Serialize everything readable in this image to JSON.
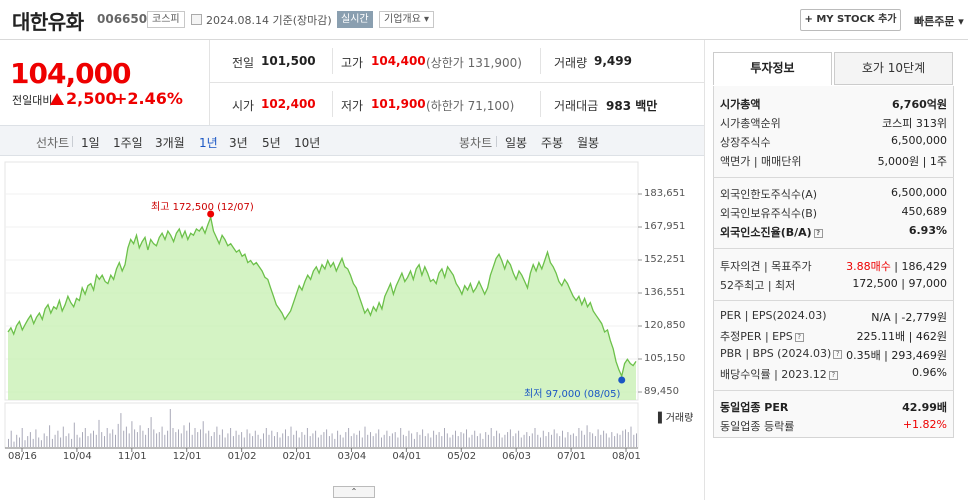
{
  "header": {
    "company_name": "대한유화",
    "code": "006650",
    "market": "코스피",
    "date_text": "2024.08.14  기준(장마감)",
    "realtime": "실시간",
    "company_overview": "기업개요 ▾",
    "mystock_button": "+ MY STOCK 추가",
    "quick_order": "빠른주문 ▾"
  },
  "price": {
    "current": "104,000",
    "change_label": "전일대비",
    "change_amount": "2,500",
    "change_percent": "+2.46%"
  },
  "stats": {
    "prev_close_label": "전일",
    "prev_close": "101,500",
    "high_label": "고가",
    "high": "104,400",
    "upper_limit": "(상한가 131,900)",
    "volume_label": "거래량",
    "volume": "9,499",
    "open_label": "시가",
    "open": "102,400",
    "low_label": "저가",
    "low": "101,900",
    "lower_limit": "(하한가 71,100)",
    "trade_value_label": "거래대금",
    "trade_value": "983 백만"
  },
  "tabs": {
    "line_label": "선차트",
    "line_periods": [
      "1일",
      "1주일",
      "3개월",
      "1년",
      "3년",
      "5년",
      "10년"
    ],
    "active_period": "1년",
    "candle_label": "봉차트",
    "candle_periods": [
      "일봉",
      "주봉",
      "월봉"
    ]
  },
  "chart": {
    "max_label": "최고 172,500 (12/07)",
    "min_label": "최저 97,000 (08/05)",
    "volume_label": "▌거래량",
    "toggle": "⌃",
    "accent_line": "#6cc04a",
    "accent_fill": "#c9f0b5"
  },
  "chart_data": {
    "type": "area",
    "y_ticks": [
      "183,651",
      "167,951",
      "152,251",
      "136,551",
      "120,850",
      "105,150",
      "89,450"
    ],
    "ylim": [
      89450,
      183651
    ],
    "x_ticks": [
      "08/16",
      "10/04",
      "11/01",
      "12/01",
      "01/02",
      "02/01",
      "03/04",
      "04/01",
      "05/02",
      "06/03",
      "07/01",
      "08/01"
    ],
    "series": [
      {
        "values": [
          118000,
          120000,
          117000,
          121000,
          123000,
          119000,
          121500,
          124000,
          126000,
          122000,
          125000,
          127000,
          124000,
          129000,
          131000,
          127000,
          130000,
          129000,
          133000,
          128000,
          131000,
          135000,
          132000,
          130000,
          134000,
          133000,
          139000,
          136000,
          140000,
          141000,
          138000,
          145000,
          143000,
          145000,
          142000,
          141000,
          145000,
          143000,
          148000,
          151000,
          147000,
          150000,
          158000,
          162000,
          160000,
          164000,
          158000,
          161000,
          163000,
          157000,
          162000,
          160000,
          159000,
          163000,
          165000,
          162000,
          166000,
          164000,
          161000,
          165000,
          167000,
          163000,
          166000,
          162000,
          165000,
          164000,
          167000,
          166000,
          168000,
          165000,
          169000,
          172500,
          166000,
          163000,
          160000,
          164000,
          162000,
          159000,
          160000,
          158000,
          156000,
          157000,
          154000,
          155000,
          151000,
          152000,
          150000,
          151000,
          149000,
          147000,
          144000,
          143000,
          139000,
          135000,
          131000,
          129000,
          127000,
          124000,
          126000,
          128000,
          132000,
          136000,
          140000,
          138000,
          142000,
          145000,
          143000,
          147000,
          149000,
          146000,
          150000,
          148000,
          152000,
          149000,
          151000,
          147000,
          150000,
          153000,
          149000,
          148000,
          145000,
          141000,
          139000,
          135000,
          131000,
          127000,
          129000,
          126000,
          130000,
          128000,
          132000,
          129000,
          135000,
          138000,
          141000,
          136000,
          140000,
          143000,
          146000,
          142000,
          144000,
          147000,
          143000,
          148000,
          150000,
          145000,
          149000,
          146000,
          142000,
          143000,
          141000,
          146000,
          148000,
          144000,
          149000,
          147000,
          145000,
          141000,
          139000,
          136000,
          140000,
          138000,
          141000,
          137000,
          139000,
          142000,
          139000,
          136000,
          139000,
          145000,
          149000,
          153000,
          155000,
          152000,
          148000,
          152000,
          150000,
          146000,
          143000,
          147000,
          145000,
          142000,
          139000,
          146000,
          150000,
          147000,
          151000,
          148000,
          152000,
          156000,
          151000,
          149000,
          146000,
          142000,
          140000,
          143000,
          141000,
          138000,
          135000,
          133000,
          135000,
          131000,
          134000,
          130000,
          132000,
          128000,
          126000,
          124000,
          122000,
          118000,
          119000,
          114000,
          110000,
          104000,
          100000,
          97000,
          103000,
          105000,
          103000,
          102000,
          104000
        ]
      }
    ],
    "volume": {
      "label": "거래량",
      "values": [
        6,
        12,
        4,
        9,
        7,
        14,
        5,
        8,
        11,
        6,
        13,
        7,
        5,
        10,
        8,
        16,
        6,
        9,
        12,
        7,
        15,
        8,
        10,
        6,
        18,
        9,
        7,
        11,
        14,
        8,
        10,
        12,
        9,
        20,
        11,
        8,
        14,
        10,
        13,
        9,
        17,
        25,
        12,
        15,
        10,
        19,
        13,
        11,
        16,
        12,
        9,
        14,
        22,
        13,
        10,
        11,
        15,
        9,
        12,
        28,
        14,
        11,
        13,
        10,
        16,
        12,
        18,
        9,
        14,
        11,
        13,
        19,
        10,
        12,
        8,
        11,
        15,
        9,
        13,
        7,
        10,
        14,
        8,
        12,
        9,
        11,
        7,
        13,
        10,
        8,
        12,
        9,
        6,
        10,
        14,
        9,
        12,
        8,
        11,
        7,
        10,
        13,
        8,
        15,
        9,
        12,
        7,
        11,
        9,
        14,
        8,
        10,
        12,
        7,
        9,
        11,
        13,
        8,
        10,
        6,
        12,
        9,
        7,
        11,
        14,
        8,
        10,
        9,
        12,
        7,
        15,
        9,
        11,
        8,
        10,
        13,
        7,
        9,
        12,
        8,
        10,
        11,
        7,
        14,
        9,
        8,
        12,
        10,
        6,
        11,
        9,
        13,
        8,
        10,
        7,
        12,
        9,
        11,
        8,
        14,
        10,
        7,
        9,
        12,
        8,
        11,
        10,
        13,
        7,
        9,
        12,
        8,
        10,
        6,
        11,
        9,
        14,
        8,
        12,
        10,
        7,
        9,
        11,
        13,
        8,
        10,
        12,
        7,
        9,
        11,
        8,
        10,
        14,
        9,
        7,
        12,
        8,
        11,
        9,
        13,
        10,
        8,
        12,
        7,
        11,
        9,
        10,
        8,
        14,
        12,
        9,
        16,
        11,
        10,
        8,
        13,
        9,
        12,
        10,
        7,
        11,
        8,
        10,
        9,
        12,
        13,
        11,
        15,
        9,
        10
      ]
    }
  },
  "sidebar": {
    "tab_invest": "투자정보",
    "tab_orderbook": "호가 10단계",
    "rows": [
      {
        "label": "시가총액",
        "value": "6,760억원",
        "bold": true
      },
      {
        "label": "시가총액순위",
        "value": "코스피 313위"
      },
      {
        "label": "상장주식수",
        "value": "6,500,000"
      },
      {
        "label": "액면가 | 매매단위",
        "value": "5,000원 | 1주"
      },
      {
        "label": "외국인한도주식수(A)",
        "value": "6,500,000"
      },
      {
        "label": "외국인보유주식수(B)",
        "value": "450,689"
      },
      {
        "label": "외국인소진율(B/A)",
        "value": "6.93%",
        "bold": true
      },
      {
        "label": "투자의견 | 목표주가",
        "value_a": "3.88매수",
        "value_b": "186,429"
      },
      {
        "label": "52주최고 | 최저",
        "value": "172,500 | 97,000"
      },
      {
        "label": "PER | EPS(2024.03)",
        "value": "N/A | -2,779원"
      },
      {
        "label": "추정PER | EPS",
        "value": "225.11배 | 462원"
      },
      {
        "label": "PBR | BPS (2024.03)",
        "value": "0.35배 | 293,469원"
      },
      {
        "label": "배당수익률 | 2023.12",
        "value": "0.96%"
      },
      {
        "label": "동일업종 PER",
        "value": "42.99배",
        "bold": true
      },
      {
        "label": "동일업종 등락률",
        "value": "+1.82%",
        "red": true
      }
    ]
  }
}
